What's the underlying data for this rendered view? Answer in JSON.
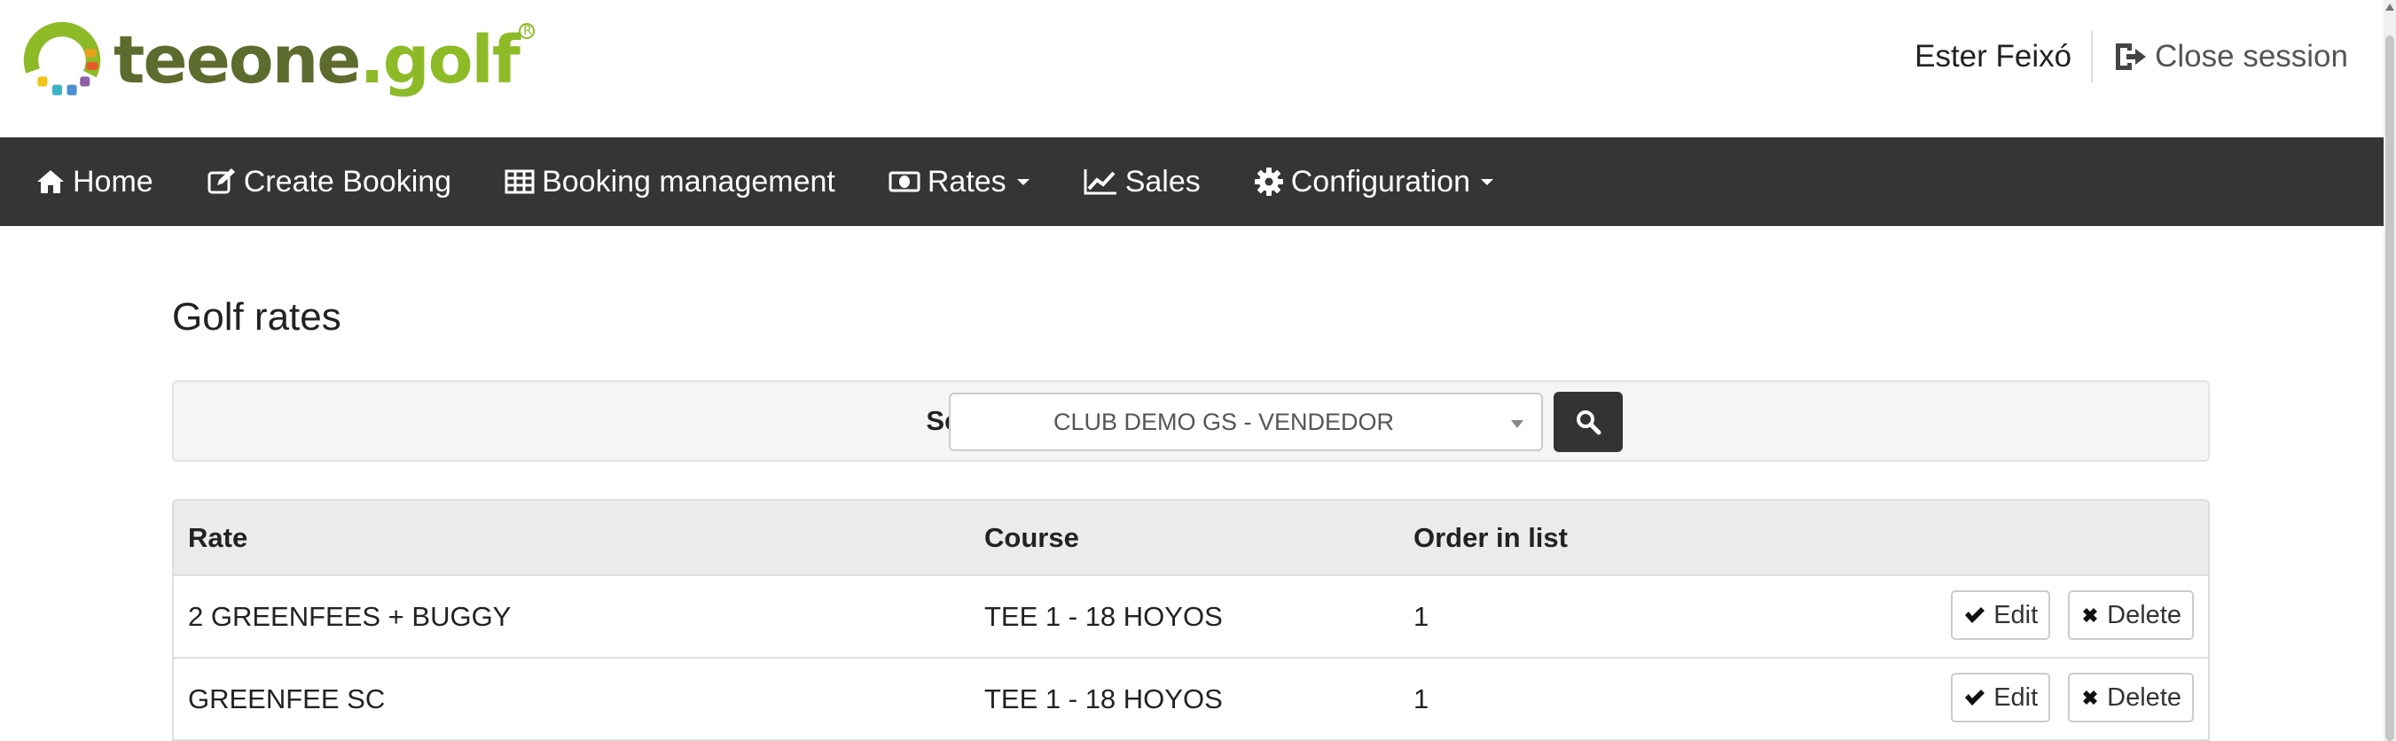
{
  "brand": {
    "text_part1": "tee",
    "text_part2": "one",
    "text_part3": ".golf",
    "reg_mark": "R",
    "colors": {
      "dark": "#5e6b2e",
      "light": "#8dbb28"
    }
  },
  "user": {
    "name": "Ester Feixó",
    "logout_label": "Close session"
  },
  "nav": {
    "items": [
      {
        "label": "Home",
        "icon": "home-icon"
      },
      {
        "label": "Create Booking",
        "icon": "edit-icon"
      },
      {
        "label": "Booking management",
        "icon": "table-icon"
      },
      {
        "label": "Rates",
        "icon": "money-icon",
        "dropdown": true
      },
      {
        "label": "Sales",
        "icon": "line-chart-icon"
      },
      {
        "label": "Configuration",
        "icon": "gear-icon",
        "dropdown": true
      }
    ]
  },
  "page": {
    "title": "Golf rates"
  },
  "filter": {
    "label": "Select course",
    "selected_course": "CLUB DEMO GS - VENDEDOR",
    "search_icon": "search-icon"
  },
  "table": {
    "headers": {
      "rate": "Rate",
      "course": "Course",
      "order": "Order in list"
    },
    "rows": [
      {
        "rate": "2 GREENFEES + BUGGY",
        "course": "TEE 1 - 18 HOYOS",
        "order": "1"
      },
      {
        "rate": "GREENFEE SC",
        "course": "TEE 1 - 18 HOYOS",
        "order": "1"
      }
    ],
    "edit_label": "Edit",
    "delete_label": "Delete"
  },
  "colors": {
    "navbar_bg": "#353535",
    "button_dark": "#333333"
  }
}
